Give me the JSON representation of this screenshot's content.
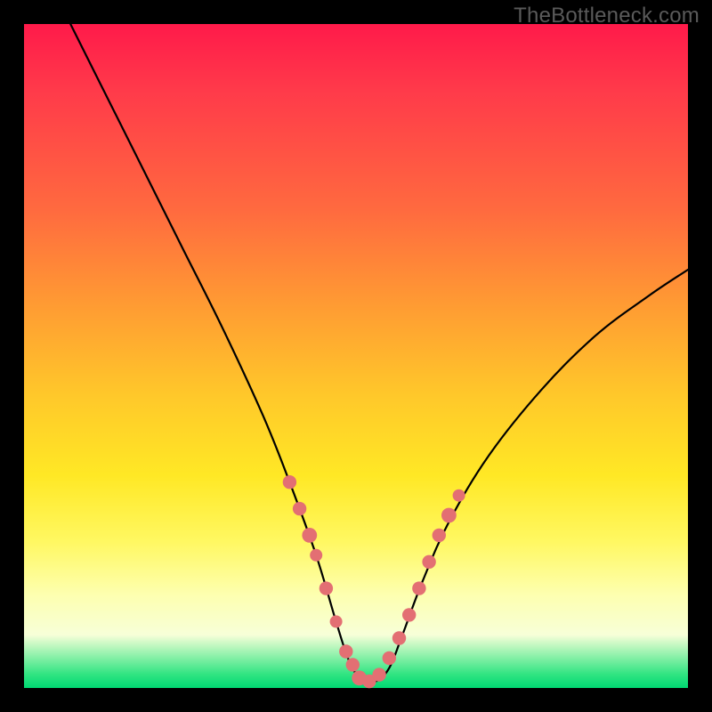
{
  "watermark": "TheBottleneck.com",
  "chart_data": {
    "type": "line",
    "title": "",
    "xlabel": "",
    "ylabel": "",
    "xlim": [
      0,
      100
    ],
    "ylim": [
      0,
      100
    ],
    "series": [
      {
        "name": "bottleneck-curve",
        "x": [
          7,
          12,
          18,
          24,
          30,
          36,
          40,
          44,
          47,
          49,
          51,
          53,
          55,
          57,
          60,
          64,
          70,
          78,
          86,
          94,
          100
        ],
        "values": [
          100,
          90,
          78,
          66,
          54,
          41,
          31,
          20,
          10,
          4,
          1,
          1,
          3,
          8,
          16,
          25,
          35,
          45,
          53,
          59,
          63
        ]
      }
    ],
    "markers": {
      "name": "highlight-points",
      "color": "#e36f73",
      "points": [
        {
          "x": 40,
          "y": 31,
          "r": 1.1
        },
        {
          "x": 41.5,
          "y": 27,
          "r": 1.1
        },
        {
          "x": 43,
          "y": 23,
          "r": 1.2
        },
        {
          "x": 44,
          "y": 20,
          "r": 1.0
        },
        {
          "x": 45.5,
          "y": 15,
          "r": 1.1
        },
        {
          "x": 47,
          "y": 10,
          "r": 1.0
        },
        {
          "x": 48.5,
          "y": 5.5,
          "r": 1.1
        },
        {
          "x": 49.5,
          "y": 3.5,
          "r": 1.1
        },
        {
          "x": 50.5,
          "y": 1.5,
          "r": 1.2
        },
        {
          "x": 52,
          "y": 1,
          "r": 1.1
        },
        {
          "x": 53.5,
          "y": 2,
          "r": 1.1
        },
        {
          "x": 55,
          "y": 4.5,
          "r": 1.1
        },
        {
          "x": 56.5,
          "y": 7.5,
          "r": 1.1
        },
        {
          "x": 58,
          "y": 11,
          "r": 1.1
        },
        {
          "x": 59.5,
          "y": 15,
          "r": 1.1
        },
        {
          "x": 61,
          "y": 19,
          "r": 1.1
        },
        {
          "x": 62.5,
          "y": 23,
          "r": 1.1
        },
        {
          "x": 64,
          "y": 26,
          "r": 1.2
        },
        {
          "x": 65.5,
          "y": 29,
          "r": 1.0
        }
      ]
    }
  }
}
